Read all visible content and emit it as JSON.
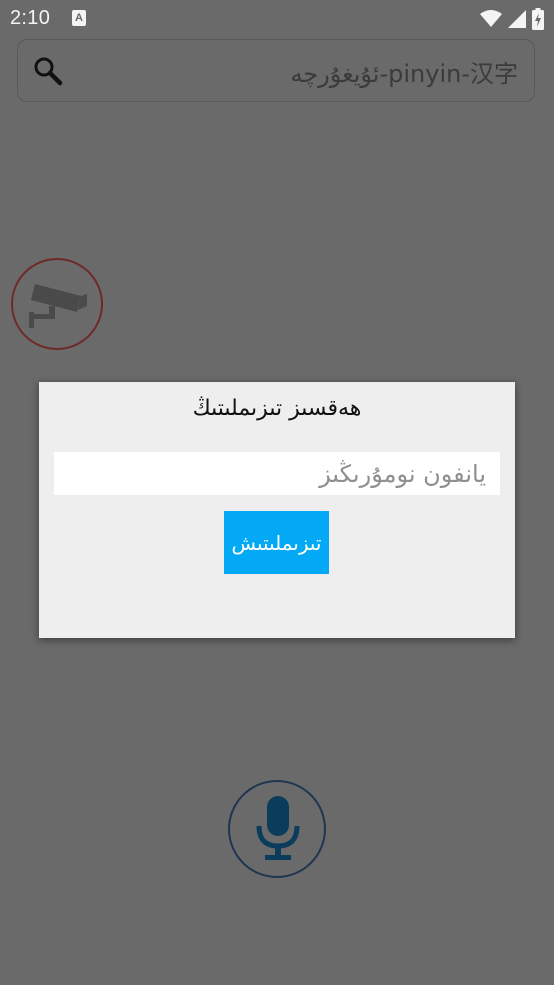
{
  "status_bar": {
    "time": "2:10",
    "notification_icon": "a-icon",
    "icons": [
      "wifi-icon",
      "signal-icon",
      "battery-charging-icon"
    ]
  },
  "search": {
    "placeholder": "ئۇيغۇرچە-pinyin-汉字"
  },
  "dialog": {
    "title": "ھەقسىز تىزىملىتىڭ",
    "phone_placeholder": "يانفون نومۇرىڭىز",
    "login_label": "تىزىملىتىش"
  },
  "colors": {
    "overlay_background": "#6a6a6a",
    "dialog_background": "#eeeeee",
    "button_accent": "#03a9f4",
    "camera_ring": "#6d2a28",
    "mic_ring": "#1f3550",
    "mic_fill": "#0c3c5c"
  },
  "icons": {
    "search": "search-icon",
    "camera": "cctv-camera-icon",
    "mic": "microphone-icon"
  }
}
